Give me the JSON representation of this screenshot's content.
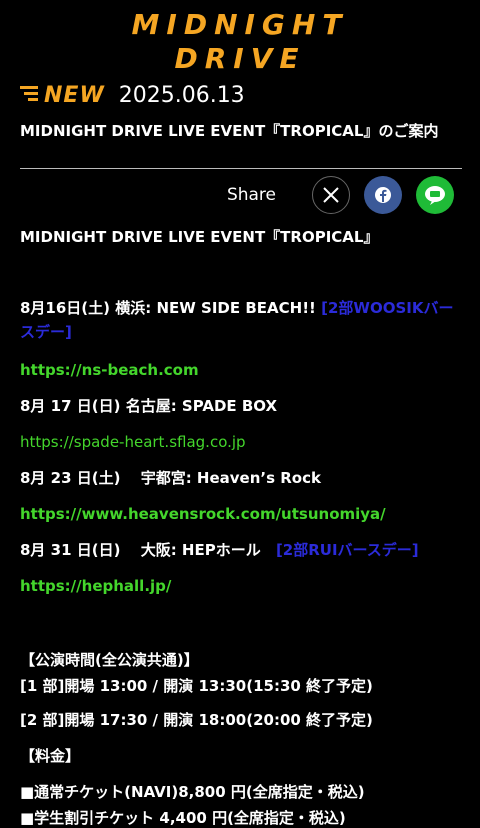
{
  "logo": {
    "line1": "MIDNIGHT",
    "line2": "DRIVE"
  },
  "news": {
    "badge": "NEW",
    "date": "2025.06.13",
    "headline": "MIDNIGHT DRIVE LIVE EVENT『TROPICAL』のご案内"
  },
  "share": {
    "label": "Share",
    "buttons": [
      "X",
      "Facebook",
      "LINE"
    ]
  },
  "article": {
    "title": "MIDNIGHT DRIVE LIVE EVENT『TROPICAL』",
    "events": [
      {
        "text": "8月16日(土) 横浜: NEW SIDE BEACH!!",
        "note": "[2部WOOSIKバースデー]",
        "url": "https://ns-beach.com"
      },
      {
        "text": "8月 17 日(日) 名古屋: SPADE BOX",
        "url": "https://spade-heart.sflag.co.jp"
      },
      {
        "text": "8月 23 日(土)　 宇都宮: Heaven’s Rock",
        "url": "https://www.heavensrock.com/utsunomiya/"
      },
      {
        "text": "8月 31 日(日)　 大阪: HEPホール",
        "note": "[2部RUIバースデー]",
        "url": "https://hephall.jp/"
      }
    ],
    "time_header": "【公演時間(全公演共通)】",
    "part1": "[1 部]開場 13:00 / 開演 13:30(15:30 終了予定)",
    "part2": "[2 部]開場 17:30 / 開演 18:00(20:00 終了予定)",
    "price_header": "【料金】",
    "price1": "■通常チケット(NAVI)8,800 円(全席指定・税込)",
    "price2": "■学生割引チケット 4,400 円(全席指定・税込)"
  }
}
